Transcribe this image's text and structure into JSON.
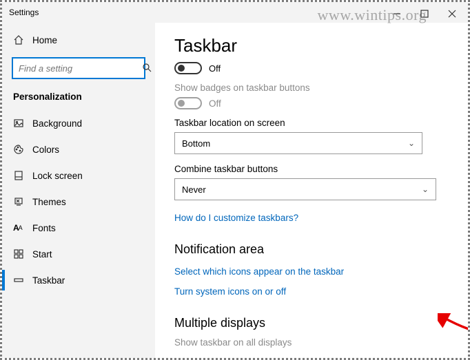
{
  "window": {
    "title": "Settings",
    "watermark": "www.wintips.org"
  },
  "sidebar": {
    "home": "Home",
    "search_placeholder": "Find a setting",
    "category": "Personalization",
    "items": [
      {
        "label": "Background"
      },
      {
        "label": "Colors"
      },
      {
        "label": "Lock screen"
      },
      {
        "label": "Themes"
      },
      {
        "label": "Fonts"
      },
      {
        "label": "Start"
      },
      {
        "label": "Taskbar"
      }
    ]
  },
  "main": {
    "heading": "Taskbar",
    "toggle1_state": "Off",
    "badges_label": "Show badges on taskbar buttons",
    "badges_state": "Off",
    "location_label": "Taskbar location on screen",
    "location_value": "Bottom",
    "combine_label": "Combine taskbar buttons",
    "combine_value": "Never",
    "customize_link": "How do I customize taskbars?",
    "notif_heading": "Notification area",
    "notif_link1": "Select which icons appear on the taskbar",
    "notif_link2": "Turn system icons on or off",
    "multi_heading": "Multiple displays",
    "multi_label": "Show taskbar on all displays"
  }
}
